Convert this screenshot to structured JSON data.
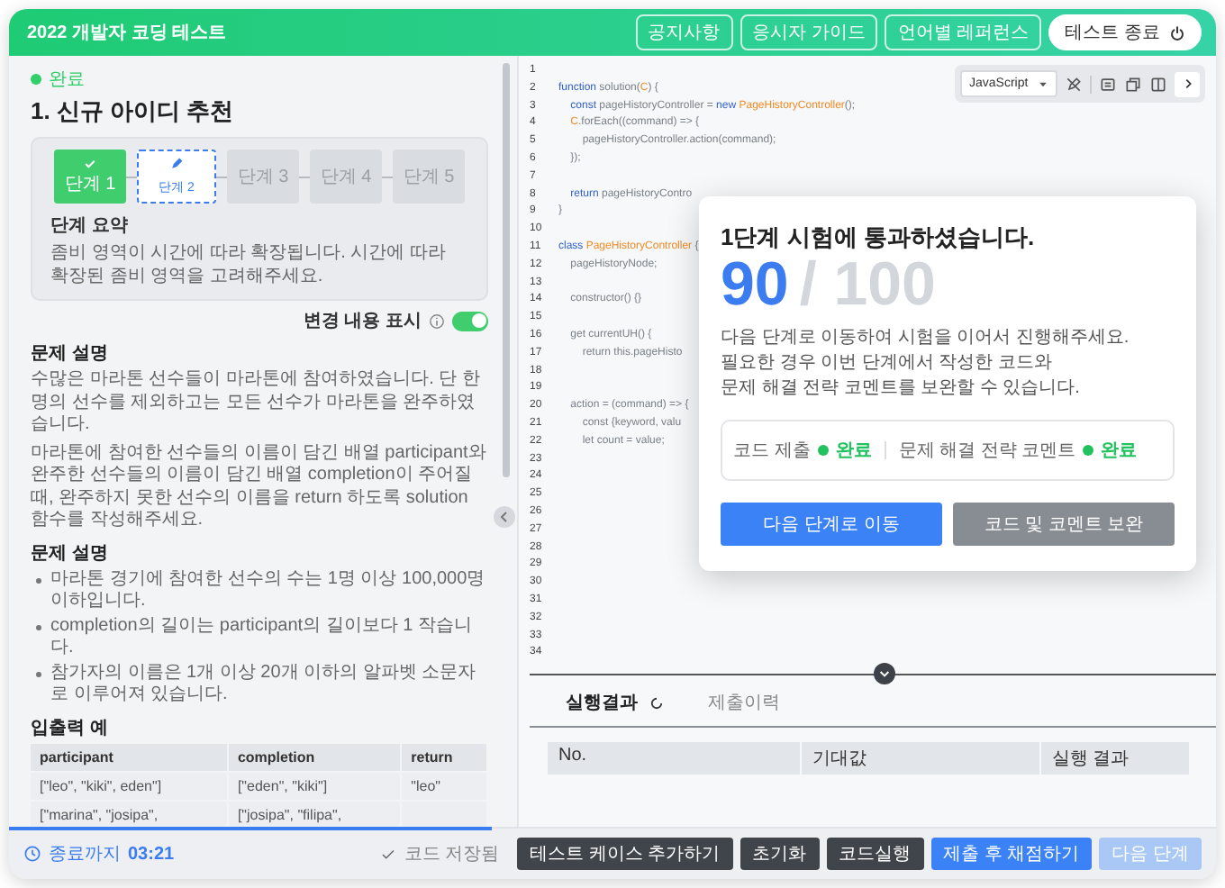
{
  "header": {
    "title": "2022 개발자 코딩 테스트",
    "buttons": [
      {
        "label": "공지사항",
        "kind": "outline"
      },
      {
        "label": "응시자 가이드",
        "kind": "outline"
      },
      {
        "label": "언어별 레퍼런스",
        "kind": "outline"
      },
      {
        "label": "테스트 종료",
        "kind": "exit"
      }
    ]
  },
  "problem": {
    "status": "완료",
    "title": "1. 신규 아이디 추천",
    "steps": [
      {
        "label": "단계 1",
        "done": true,
        "selected": false
      },
      {
        "label": "단계 2",
        "done": false,
        "selected": true
      },
      {
        "label": "단계 3",
        "done": false,
        "selected": false
      },
      {
        "label": "단계 4",
        "done": false,
        "selected": false
      },
      {
        "label": "단계 5",
        "done": false,
        "selected": false
      }
    ],
    "summary_title": "단계 요약",
    "summary": "좀비 영역이 시간에 따라 확장됩니다. 시간에 따라 확장된 좀비 영역을 고려해주세요.",
    "toggle": {
      "label": "변경 내용 표시",
      "on": true
    },
    "sections": [
      {
        "heading": "문제 설명",
        "paragraphs": [
          "수많은 마라톤 선수들이 마라톤에 참여하였습니다. 단 한 명의 선수를 제외하고는 모든 선수가 마라톤을 완주하였습니다.",
          "마라톤에 참여한 선수들의 이름이 담긴 배열 participant와 완주한 선수들의 이름이 담긴 배열 completion이 주어질 때, 완주하지 못한 선수의 이름을 return 하도록 solution 함수를 작성해주세요."
        ]
      },
      {
        "heading": "문제 설명",
        "bullets": [
          "마라톤 경기에 참여한 선수의 수는 1명 이상 100,000명 이하입니다.",
          "completion의 길이는 participant의 길이보다 1 작습니다.",
          "참가자의 이름은 1개 이상 20개 이하의 알파벳 소문자로 이루어져 있습니다."
        ]
      },
      {
        "heading": "입출력 예",
        "table": {
          "columns": [
            "participant",
            "completion",
            "return"
          ],
          "rows": [
            [
              "[\"leo\", \"kiki\", eden\"]",
              "[\"eden\", \"kiki\"]",
              "\"leo\""
            ],
            [
              "[\"marina\", \"josipa\",",
              "[\"josipa\", \"filipa\",",
              ""
            ]
          ]
        }
      }
    ]
  },
  "editor": {
    "language": "JavaScript",
    "lines": [
      {
        "number": "1"
      },
      {
        "number": "2",
        "tokens": [
          {
            "kind": "keyword",
            "text": "function"
          },
          {
            "kind": "plain",
            "text": " solution("
          },
          {
            "kind": "name",
            "text": "C"
          },
          {
            "kind": "plain",
            "text": ") {"
          }
        ]
      },
      {
        "number": "3",
        "tokens": [
          {
            "kind": "keyword",
            "text": "    const"
          },
          {
            "kind": "plain",
            "text": " pageHistoryController = "
          },
          {
            "kind": "keyword",
            "text": "new"
          },
          {
            "kind": "name",
            "text": " PageHistoryController"
          },
          {
            "kind": "plain",
            "text": "();"
          }
        ]
      },
      {
        "number": "4",
        "tokens": [
          {
            "kind": "name",
            "text": "    C"
          },
          {
            "kind": "plain",
            "text": ".forEach((command) => {"
          }
        ]
      },
      {
        "number": "5",
        "tokens": [
          {
            "kind": "plain",
            "text": "        pageHistoryController.action(command);"
          }
        ]
      },
      {
        "number": "6",
        "tokens": [
          {
            "kind": "plain",
            "text": "    });"
          }
        ]
      },
      {
        "number": "7"
      },
      {
        "number": "8",
        "tokens": [
          {
            "kind": "keyword",
            "text": "    return"
          },
          {
            "kind": "plain",
            "text": " pageHistoryContro"
          }
        ]
      },
      {
        "number": "9",
        "tokens": [
          {
            "kind": "plain",
            "text": "}"
          }
        ]
      },
      {
        "number": "10"
      },
      {
        "number": "11",
        "tokens": [
          {
            "kind": "keyword",
            "text": "class"
          },
          {
            "kind": "name",
            "text": " PageHistoryController"
          },
          {
            "kind": "plain",
            "text": " {"
          }
        ]
      },
      {
        "number": "12",
        "tokens": [
          {
            "kind": "plain",
            "text": "    pageHistoryNode;"
          }
        ]
      },
      {
        "number": "13"
      },
      {
        "number": "14",
        "tokens": [
          {
            "kind": "plain",
            "text": "    constructor() {}"
          }
        ]
      },
      {
        "number": "15"
      },
      {
        "number": "16",
        "tokens": [
          {
            "kind": "plain",
            "text": "    get currentUH() {"
          }
        ]
      },
      {
        "number": "17",
        "tokens": [
          {
            "kind": "plain",
            "text": "        return this.pageHisto"
          }
        ]
      },
      {
        "number": "18"
      },
      {
        "number": "19"
      },
      {
        "number": "20",
        "tokens": [
          {
            "kind": "plain",
            "text": "    action = (command) => {"
          }
        ]
      },
      {
        "number": "21",
        "tokens": [
          {
            "kind": "plain",
            "text": "        const {keyword, valu"
          }
        ]
      },
      {
        "number": "22",
        "tokens": [
          {
            "kind": "plain",
            "text": "        let count = value;"
          }
        ]
      },
      {
        "number": "23"
      },
      {
        "number": "24"
      },
      {
        "number": "25"
      },
      {
        "number": "26"
      },
      {
        "number": "27"
      },
      {
        "number": "28"
      },
      {
        "number": "29"
      },
      {
        "number": "30"
      },
      {
        "number": "31"
      },
      {
        "number": "32"
      },
      {
        "number": "33"
      },
      {
        "number": "34"
      }
    ]
  },
  "result_tabs": [
    {
      "label": "실행결과",
      "selected": true
    },
    {
      "label": "제출이력",
      "selected": false
    }
  ],
  "result_table": {
    "columns": [
      "No.",
      "기대값",
      "실행 결과"
    ]
  },
  "modal": {
    "title": "1단계 시험에 통과하셨습니다.",
    "score": "90",
    "total": "/ 100",
    "lines": [
      "다음 단계로 이동하여 시험을 이어서 진행해주세요.",
      "필요한 경우 이번 단계에서 작성한 코드와",
      "문제 해결 전략 코멘트를 보완할 수 있습니다."
    ],
    "checks": [
      {
        "label": "코드 제출",
        "status": "완료",
        "done": true
      },
      {
        "label": "문제 해결 전략 코멘트",
        "status": "완료",
        "done": true
      }
    ],
    "buttons": [
      {
        "label": "다음 단계로 이동",
        "kind": "primary"
      },
      {
        "label": "코드 및 코멘트 보완",
        "kind": "secondary"
      }
    ]
  },
  "footer": {
    "timer_label": "종료까지",
    "time": "03:21",
    "progress": {
      "level": 0.4
    },
    "saved": "코드 저장됨",
    "buttons": [
      {
        "label": "테스트 케이스 추가하기",
        "kind": "dark",
        "disabled": false
      },
      {
        "label": "초기화",
        "kind": "dark",
        "disabled": false
      },
      {
        "label": "코드실행",
        "kind": "dark",
        "disabled": false
      },
      {
        "label": "제출 후 채점하기",
        "kind": "primary",
        "disabled": false
      },
      {
        "label": "다음 단계",
        "kind": "primary",
        "disabled": true
      }
    ]
  }
}
